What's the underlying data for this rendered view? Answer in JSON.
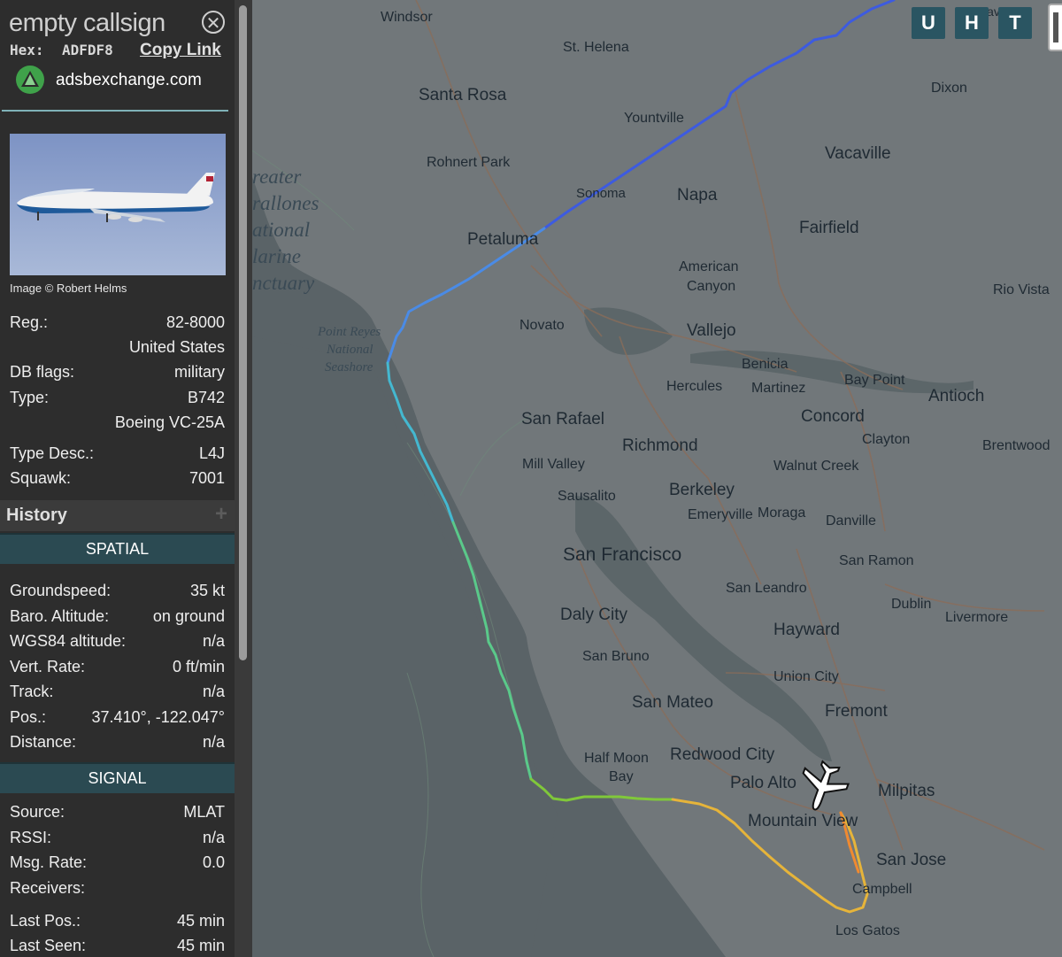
{
  "aircraft": {
    "callsign": "empty callsign",
    "hex_label": "Hex:",
    "hex": "ADFDF8",
    "copy_link": "Copy Link",
    "source_site": "adsbexchange.com",
    "image_credit": "Image © Robert Helms"
  },
  "info_rows": [
    {
      "key": "Reg.:",
      "value": "82-8000"
    },
    {
      "key": "",
      "value": "United States"
    },
    {
      "key": "DB flags:",
      "value": "military"
    },
    {
      "key": "Type:",
      "value": "B742"
    },
    {
      "key": "",
      "value": "Boeing VC-25A"
    },
    {
      "key": "Type Desc.:",
      "value": "L4J"
    },
    {
      "key": "Squawk:",
      "value": "7001"
    }
  ],
  "history": {
    "label": "History",
    "expand": "+"
  },
  "spatial": {
    "header": "SPATIAL",
    "rows": [
      {
        "key": "Groundspeed:",
        "value": "35 kt"
      },
      {
        "key": "Baro. Altitude:",
        "value": "on ground"
      },
      {
        "key": "WGS84 altitude:",
        "value": "n/a"
      },
      {
        "key": "Vert. Rate:",
        "value": "0 ft/min"
      },
      {
        "key": "Track:",
        "value": "n/a"
      },
      {
        "key": "Pos.:",
        "value": "37.410°, -122.047°"
      },
      {
        "key": "Distance:",
        "value": "n/a"
      }
    ]
  },
  "signal": {
    "header": "SIGNAL",
    "rows": [
      {
        "key": "Source:",
        "value": "MLAT"
      },
      {
        "key": "RSSI:",
        "value": "n/a"
      },
      {
        "key": "Msg. Rate:",
        "value": "0.0"
      },
      {
        "key": "Receivers:",
        "value": ""
      },
      {
        "key": "Last Pos.:",
        "value": "45 min"
      },
      {
        "key": "Last Seen:",
        "value": "45 min"
      }
    ]
  },
  "map_buttons": [
    "U",
    "H",
    "T"
  ],
  "map_places": [
    "Windsor",
    "St. Helena",
    "Santa Rosa",
    "Yountville",
    "Dixon",
    "Davis",
    "Rohnert Park",
    "Vacaville",
    "Sonoma",
    "Napa",
    "Petaluma",
    "Fairfield",
    "American",
    "Canyon",
    "Rio Vista",
    "Novato",
    "Vallejo",
    "Benicia",
    "Hercules",
    "Martinez",
    "Bay Point",
    "Antioch",
    "San Rafael",
    "Concord",
    "Richmond",
    "Clayton",
    "Brentwood",
    "Mill Valley",
    "Walnut Creek",
    "Berkeley",
    "Sausalito",
    "Emeryville",
    "Moraga",
    "Danville",
    "San Francisco",
    "San Ramon",
    "San Leandro",
    "Daly City",
    "Dublin",
    "Livermore",
    "Hayward",
    "San Bruno",
    "Union City",
    "San Mateo",
    "Fremont",
    "Half Moon",
    "Bay",
    "Redwood City",
    "Palo Alto",
    "Milpitas",
    "Mountain View",
    "San Jose",
    "Campbell",
    "Los Gatos",
    "Point Reyes",
    "National",
    "Seashore",
    "reater",
    "rallones",
    "ational",
    "larine",
    "nctuary"
  ],
  "colors": {
    "track_start": "#2a3fd6",
    "track_mid": "#40c9c0",
    "track_green": "#7ad13a",
    "track_end": "#f0a030",
    "panel_bg": "#2d2d2d",
    "section_bg": "#2b4a52",
    "map_button_bg": "#2a5562"
  }
}
